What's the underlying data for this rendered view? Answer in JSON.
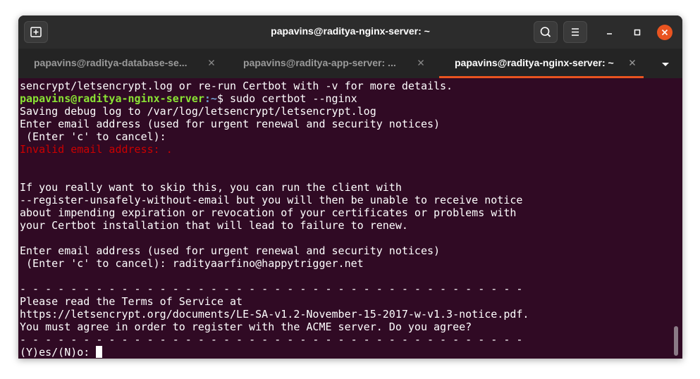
{
  "window": {
    "title": "papavins@raditya-nginx-server: ~"
  },
  "icons": {
    "new_tab": "new-tab-icon",
    "search": "search-icon",
    "menu": "hamburger-menu-icon",
    "minimize": "minimize-icon",
    "maximize": "maximize-icon",
    "close": "close-icon",
    "tab_close": "close-icon",
    "tab_dropdown": "chevron-down-icon"
  },
  "colors": {
    "terminal_bg": "#300a24",
    "accent": "#e95420",
    "prompt_user": "#8ae234",
    "prompt_path": "#729fcf",
    "error": "#cc0000"
  },
  "tabs": [
    {
      "label": "papavins@raditya-database-se...",
      "active": false
    },
    {
      "label": "papavins@raditya-app-server: ...",
      "active": false
    },
    {
      "label": "papavins@raditya-nginx-server: ~",
      "active": true
    }
  ],
  "terminal": {
    "line_01": "sencrypt/letsencrypt.log or re-run Certbot with -v for more details.",
    "prompt_user_host": "papavins@raditya-nginx-server",
    "prompt_path": ":~",
    "prompt_command": "$ sudo certbot --nginx",
    "line_03": "Saving debug log to /var/log/letsencrypt/letsencrypt.log",
    "line_04": "Enter email address (used for urgent renewal and security notices)",
    "line_05": " (Enter 'c' to cancel):",
    "line_06_error": "Invalid email address: .",
    "line_09": "If you really want to skip this, you can run the client with",
    "line_10": "--register-unsafely-without-email but you will then be unable to receive notice",
    "line_11": "about impending expiration or revocation of your certificates or problems with",
    "line_12": "your Certbot installation that will lead to failure to renew.",
    "line_14": "Enter email address (used for urgent renewal and security notices)",
    "line_15": " (Enter 'c' to cancel): radityaarfino@happytrigger.net",
    "line_17": "- - - - - - - - - - - - - - - - - - - - - - - - - - - - - - - - - - - - - - - -",
    "line_18": "Please read the Terms of Service at",
    "line_19": "https://letsencrypt.org/documents/LE-SA-v1.2-November-15-2017-w-v1.3-notice.pdf.",
    "line_20": "You must agree in order to register with the ACME server. Do you agree?",
    "line_21": "- - - - - - - - - - - - - - - - - - - - - - - - - - - - - - - - - - - - - - - -",
    "line_22_prompt": "(Y)es/(N)o: "
  }
}
